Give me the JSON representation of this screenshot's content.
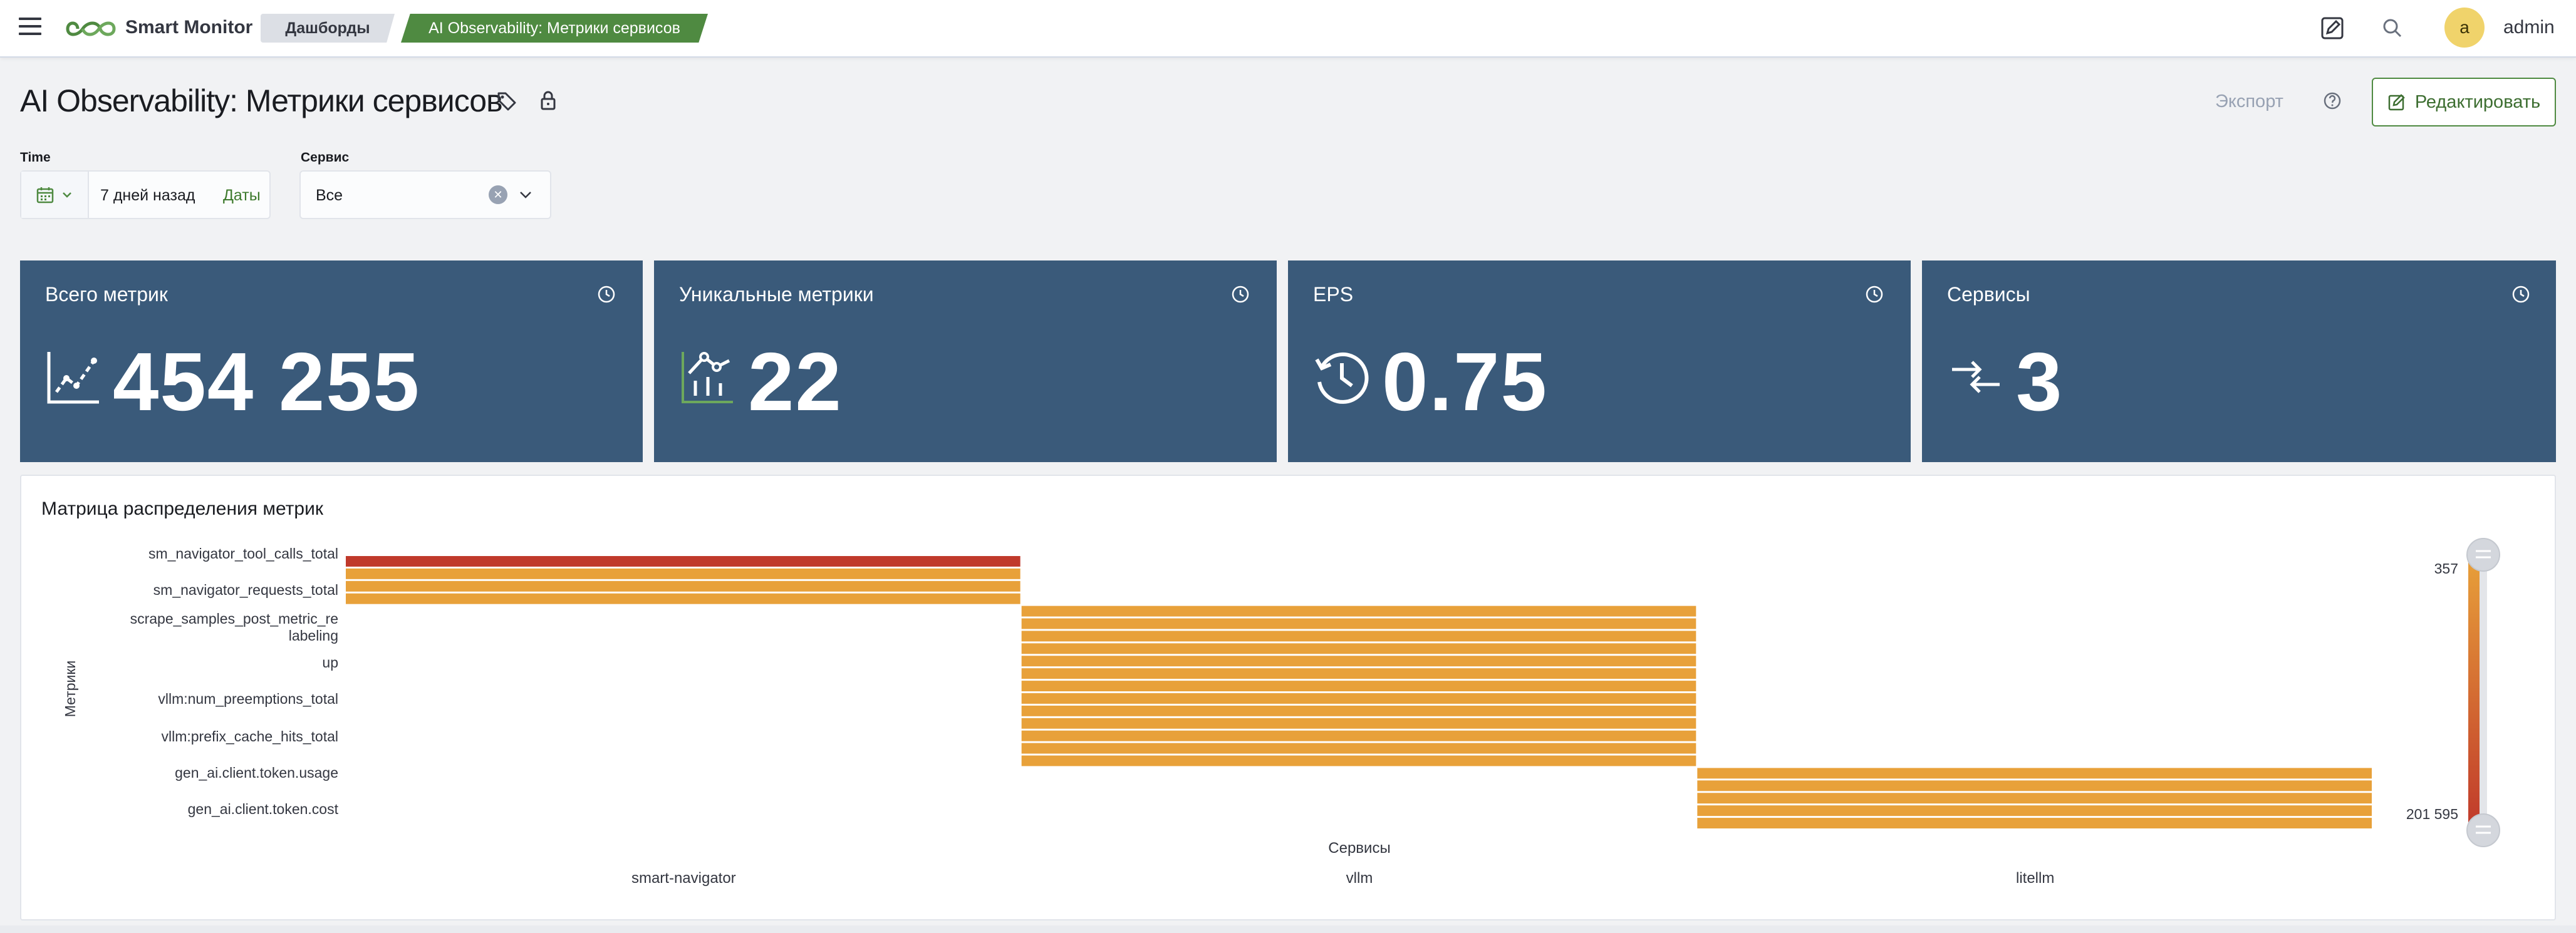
{
  "header": {
    "app_name": "Smart Monitor",
    "breadcrumbs": [
      "Дашборды",
      "AI Observability: Метрики сервисов"
    ],
    "user": {
      "avatar_letter": "a",
      "name": "admin"
    }
  },
  "page": {
    "title": "AI Observability: Метрики сервисов",
    "export_label": "Экспорт",
    "edit_label": "Редактировать"
  },
  "filters": {
    "time": {
      "label": "Time",
      "value": "7 дней назад",
      "dates_link": "Даты"
    },
    "service": {
      "label": "Сервис",
      "value": "Все"
    }
  },
  "cards": [
    {
      "title": "Всего метрик",
      "value": "454 255",
      "icon": "trend-chart-icon"
    },
    {
      "title": "Уникальные метрики",
      "value": "22",
      "icon": "analytics-icon"
    },
    {
      "title": "EPS",
      "value": "0.75",
      "icon": "history-clock-icon"
    },
    {
      "title": "Сервисы",
      "value": "3",
      "icon": "arrows-in-icon"
    }
  ],
  "colors": {
    "accent_green": "#4f8a41",
    "card_bg": "#3a5a7a",
    "heat_high": "#c0392b",
    "heat_low": "#e8a13a"
  },
  "chart_data": {
    "type": "heatmap",
    "title": "Матрица распределения метрик",
    "xlabel": "Сервисы",
    "ylabel": "Метрики",
    "x_categories": [
      "smart-navigator",
      "vllm",
      "litellm"
    ],
    "y_tick_labels": [
      "sm_navigator_tool_calls_total",
      "sm_navigator_requests_total",
      "scrape_samples_post_metric_relabeling",
      "up",
      "vllm:num_preemptions_total",
      "vllm:prefix_cache_hits_total",
      "gen_ai.client.token.usage",
      "gen_ai.client.token.cost"
    ],
    "color_scale": {
      "min": 357,
      "max": 201595,
      "min_label": "357",
      "max_label": "201 595"
    },
    "row_groups": [
      {
        "service": "smart-navigator",
        "rows": 4,
        "high_rows": 1
      },
      {
        "service": "vllm",
        "rows": 13,
        "high_rows": 0
      },
      {
        "service": "litellm",
        "rows": 5,
        "high_rows": 0
      }
    ]
  }
}
